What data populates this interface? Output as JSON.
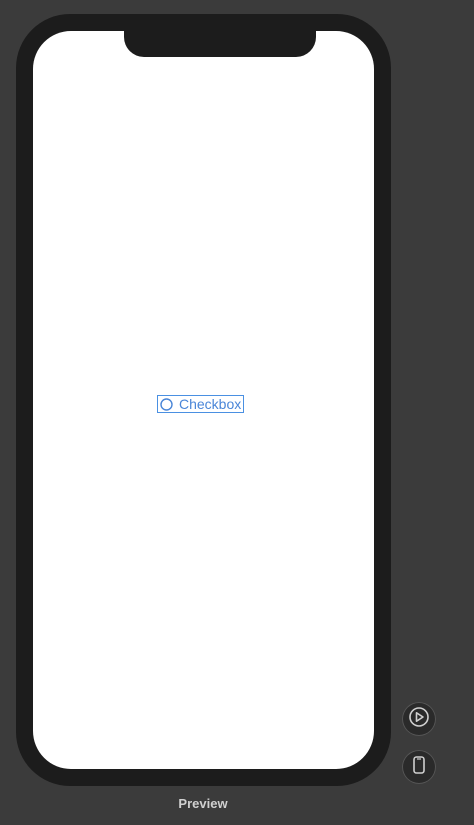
{
  "canvas": {
    "background": "#3b3b3b",
    "preview_label": "Preview"
  },
  "device": {
    "frame_color": "#1c1c1c",
    "screen_color": "#ffffff"
  },
  "checkbox": {
    "label": "Checkbox",
    "checked": false,
    "accent_color": "#4a90e2"
  },
  "controls": {
    "live_preview_icon": "play-circle-icon",
    "device_icon": "iphone-icon"
  }
}
